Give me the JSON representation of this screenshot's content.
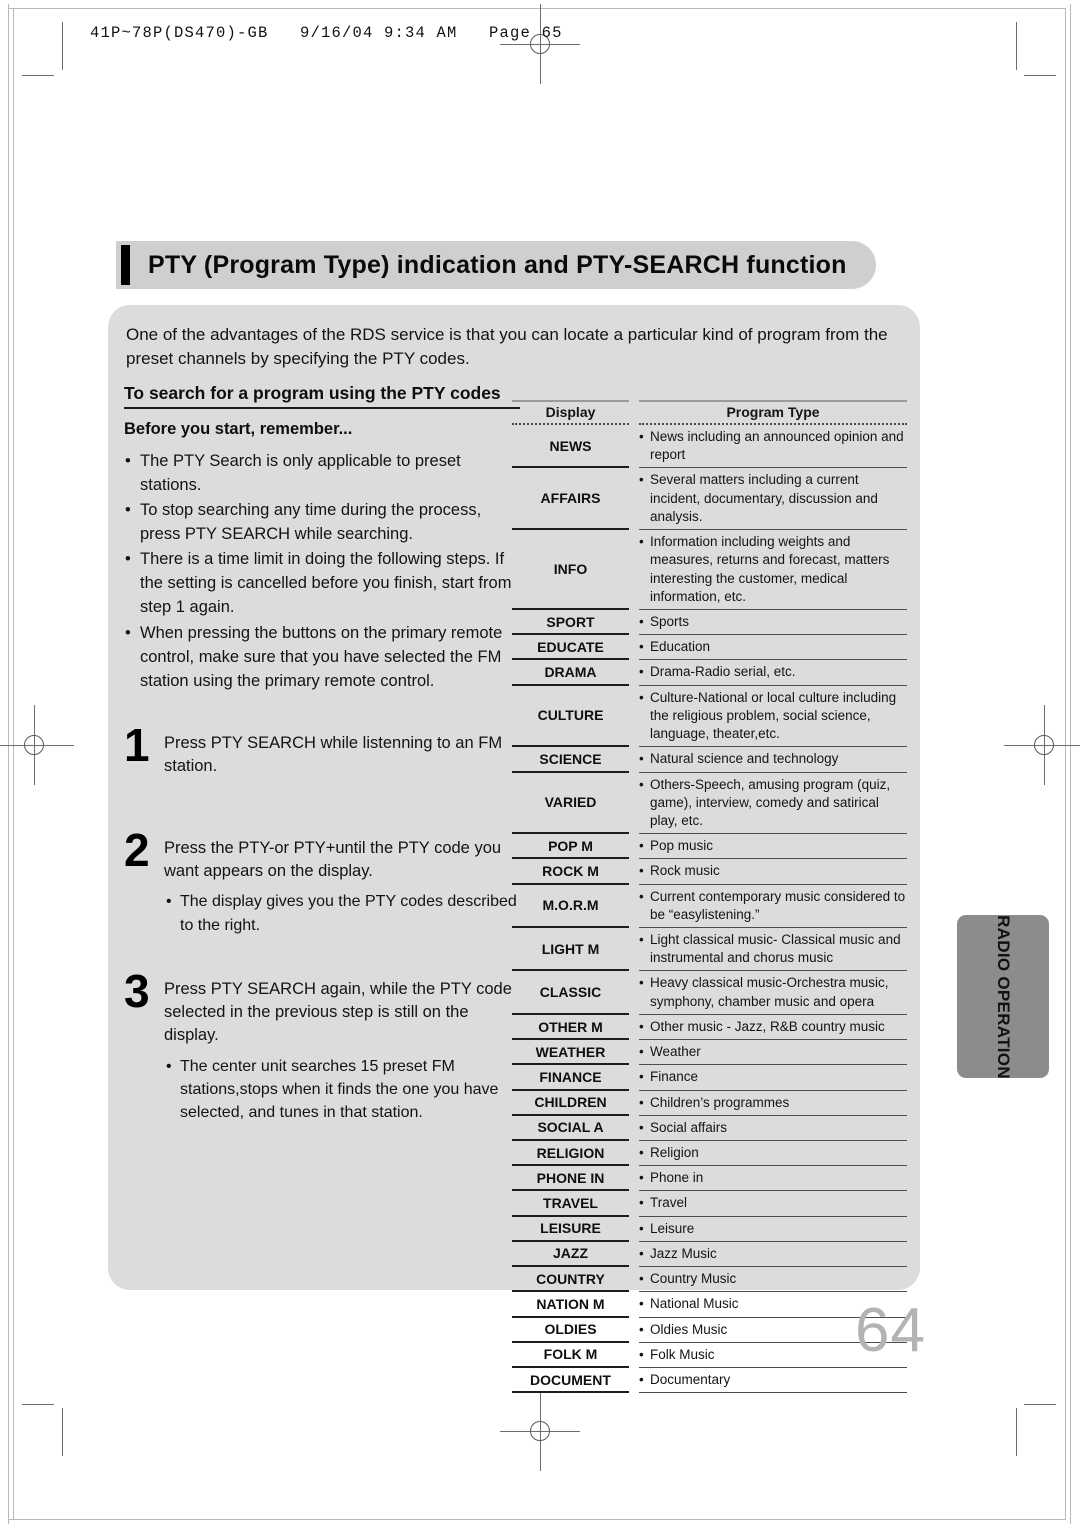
{
  "print_header": "41P~78P(DS470)-GB   9/16/04 9:34 AM   Page 65",
  "page_number": "64",
  "side_tab": {
    "label": "RADIO OPERATION"
  },
  "header": {
    "title": "PTY (Program Type) indication and PTY-SEARCH function"
  },
  "intro": "One  of the advantages of the RDS service is that you can locate a particular kind of program from the preset channels by specifying the PTY codes.",
  "left_column": {
    "section_heading": "To search for a program using the PTY codes",
    "before_heading": "Before you start, remember...",
    "notes": [
      "The PTY Search is only applicable to preset stations.",
      "To stop searching any time during the process, press PTY SEARCH while searching.",
      "There is a time limit in doing the following steps. If the setting is cancelled before you finish, start from step 1 again.",
      "When pressing the buttons on the primary remote control, make sure that you have selected the FM station using the primary remote control."
    ],
    "steps": [
      {
        "number": "1",
        "text": "Press PTY SEARCH while listenning to an FM station.",
        "subnotes": []
      },
      {
        "number": "2",
        "text": "Press the PTY-or PTY+until the PTY code you want appears on the display.",
        "subnotes": [
          "The display gives you the PTY codes described to the right."
        ]
      },
      {
        "number": "3",
        "text": "Press PTY SEARCH again, while the PTY code selected in the previous step is still on the display.",
        "subnotes": [
          "The center unit searches 15 preset FM stations,stops when it finds the one you have selected, and tunes in that station."
        ]
      }
    ]
  },
  "table": {
    "columns": [
      "Display",
      "Program Type"
    ],
    "bullet": "•",
    "rows": [
      {
        "display": "NEWS",
        "type": "News including an announced opinion and report"
      },
      {
        "display": "AFFAIRS",
        "type": "Several matters including a current incident, documentary, discussion and analysis."
      },
      {
        "display": "INFO",
        "type": "Information including weights and measures, returns and forecast, matters interesting the customer, medical information, etc."
      },
      {
        "display": "SPORT",
        "type": "Sports"
      },
      {
        "display": "EDUCATE",
        "type": "Education"
      },
      {
        "display": "DRAMA",
        "type": "Drama-Radio serial, etc."
      },
      {
        "display": "CULTURE",
        "type": "Culture-National or local culture including the religious problem, social science, language, theater,etc."
      },
      {
        "display": "SCIENCE",
        "type": "Natural science and technology"
      },
      {
        "display": "VARIED",
        "type": "Others-Speech, amusing program (quiz, game), interview, comedy and satirical play, etc."
      },
      {
        "display": "POP M",
        "type": "Pop music"
      },
      {
        "display": "ROCK M",
        "type": "Rock music"
      },
      {
        "display": "M.O.R.M",
        "type": "Current contemporary music considered to be “easylistening.”"
      },
      {
        "display": "LIGHT M",
        "type": "Light classical music- Classical music and instrumental and chorus music"
      },
      {
        "display": "CLASSIC",
        "type": "Heavy classical  music-Orchestra music, symphony, chamber music and opera"
      },
      {
        "display": "OTHER M",
        "type": "Other music - Jazz, R&B country music"
      },
      {
        "display": "WEATHER",
        "type": "Weather"
      },
      {
        "display": "FINANCE",
        "type": "Finance"
      },
      {
        "display": "CHILDREN",
        "type": "Children’s programmes"
      },
      {
        "display": "SOCIAL A",
        "type": "Social affairs"
      },
      {
        "display": "RELIGION",
        "type": "Religion"
      },
      {
        "display": "PHONE IN",
        "type": "Phone in"
      },
      {
        "display": "TRAVEL",
        "type": "Travel"
      },
      {
        "display": "LEISURE",
        "type": "Leisure"
      },
      {
        "display": "JAZZ",
        "type": "Jazz Music"
      },
      {
        "display": "COUNTRY",
        "type": "Country Music"
      },
      {
        "display": "NATION M",
        "type": "National Music"
      },
      {
        "display": "OLDIES",
        "type": "Oldies Music"
      },
      {
        "display": "FOLK M",
        "type": "Folk Music"
      },
      {
        "display": "DOCUMENT",
        "type": "Documentary"
      }
    ]
  },
  "colors": {
    "panel_bg": "#dcdcdc",
    "banner_bg": "#cfcfcf",
    "accent_bar": "#000000",
    "side_tab_bg": "#8c8c8c",
    "page_number": "#b3b3b3"
  }
}
